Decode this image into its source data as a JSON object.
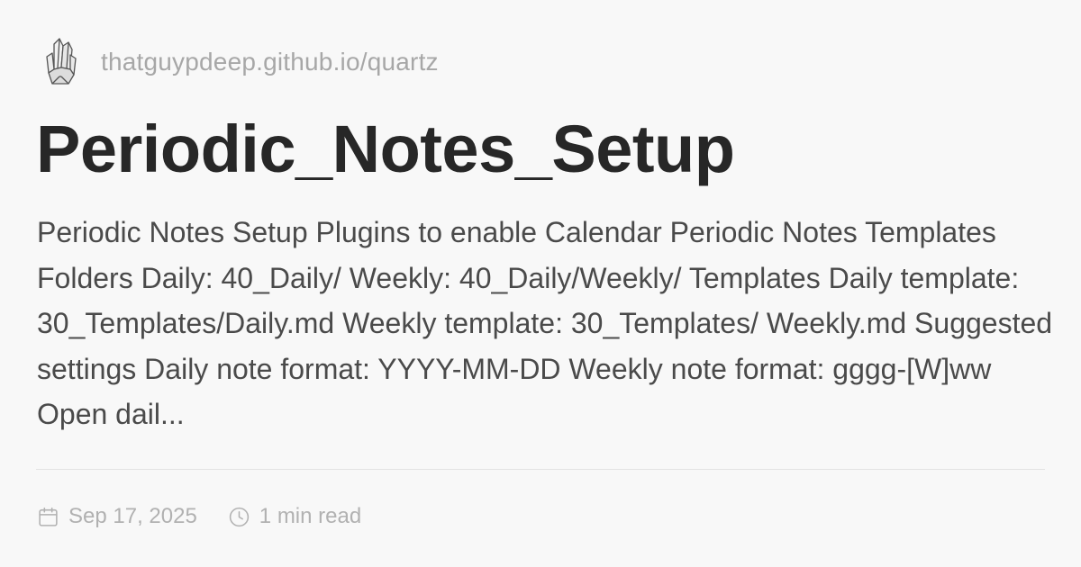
{
  "site": {
    "logo_icon": "crystal-icon",
    "url": "thatguypdeep.github.io/quartz"
  },
  "page": {
    "title": "Periodic_Notes_Setup",
    "description": "Periodic Notes Setup Plugins to enable Calendar Periodic Notes Templates Folders Daily: 40_Daily/ Weekly: 40_Daily/Weekly/ Templates Daily template: 30_Templates/Daily.md Weekly template: 30_Templates/ Weekly.md Suggested settings Daily note format: YYYY-MM-DD Weekly note format: gggg-[W]ww Open dail..."
  },
  "meta": {
    "date_icon": "calendar-icon",
    "date": "Sep 17, 2025",
    "reading_time_icon": "clock-icon",
    "reading_time": "1 min read"
  },
  "colors": {
    "background": "#f8f8f8",
    "title": "#272727",
    "body_text": "#4a4a4a",
    "muted_text": "#b1b1b1"
  }
}
